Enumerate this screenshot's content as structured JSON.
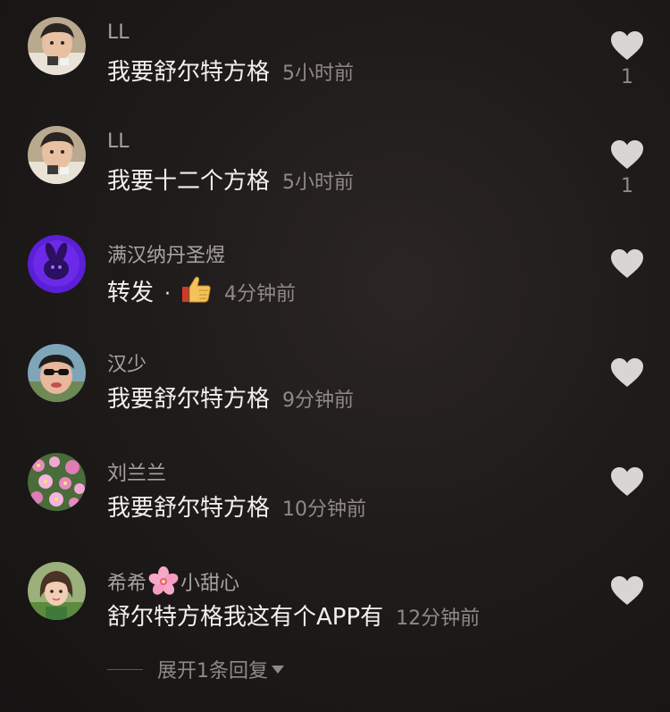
{
  "colors": {
    "background": "#1f1b1b",
    "username": "#a7a29f",
    "content": "#f2f0ee",
    "time": "#8f8a87",
    "heart": "#d8d6d4"
  },
  "comments": [
    {
      "username": "LL",
      "content": "我要舒尔特方格",
      "time": "5小时前",
      "like_count": "1",
      "avatar_icon": "child-avatar"
    },
    {
      "username": "LL",
      "content": "我要十二个方格",
      "time": "5小时前",
      "like_count": "1",
      "avatar_icon": "child-avatar"
    },
    {
      "username": "满汉纳丹圣煜",
      "content": "转发",
      "separator": "·",
      "emoji_icon": "thumbs-up-icon",
      "time": "4分钟前",
      "like_count": "",
      "avatar_icon": "purple-bunny-avatar"
    },
    {
      "username": "汉少",
      "content": "我要舒尔特方格",
      "time": "9分钟前",
      "like_count": "",
      "avatar_icon": "sunglasses-man-avatar"
    },
    {
      "username": "刘兰兰",
      "content": "我要舒尔特方格",
      "time": "10分钟前",
      "like_count": "",
      "avatar_icon": "pink-flowers-avatar"
    },
    {
      "username_part1": "希希",
      "username_emoji": "cherry-blossom-icon",
      "username_part2": "小甜心",
      "content": "舒尔特方格我这有个APP有",
      "time": "12分钟前",
      "like_count": "",
      "avatar_icon": "girl-avatar"
    }
  ],
  "expand_replies": {
    "label": "展开1条回复",
    "icon": "caret-down-icon"
  }
}
